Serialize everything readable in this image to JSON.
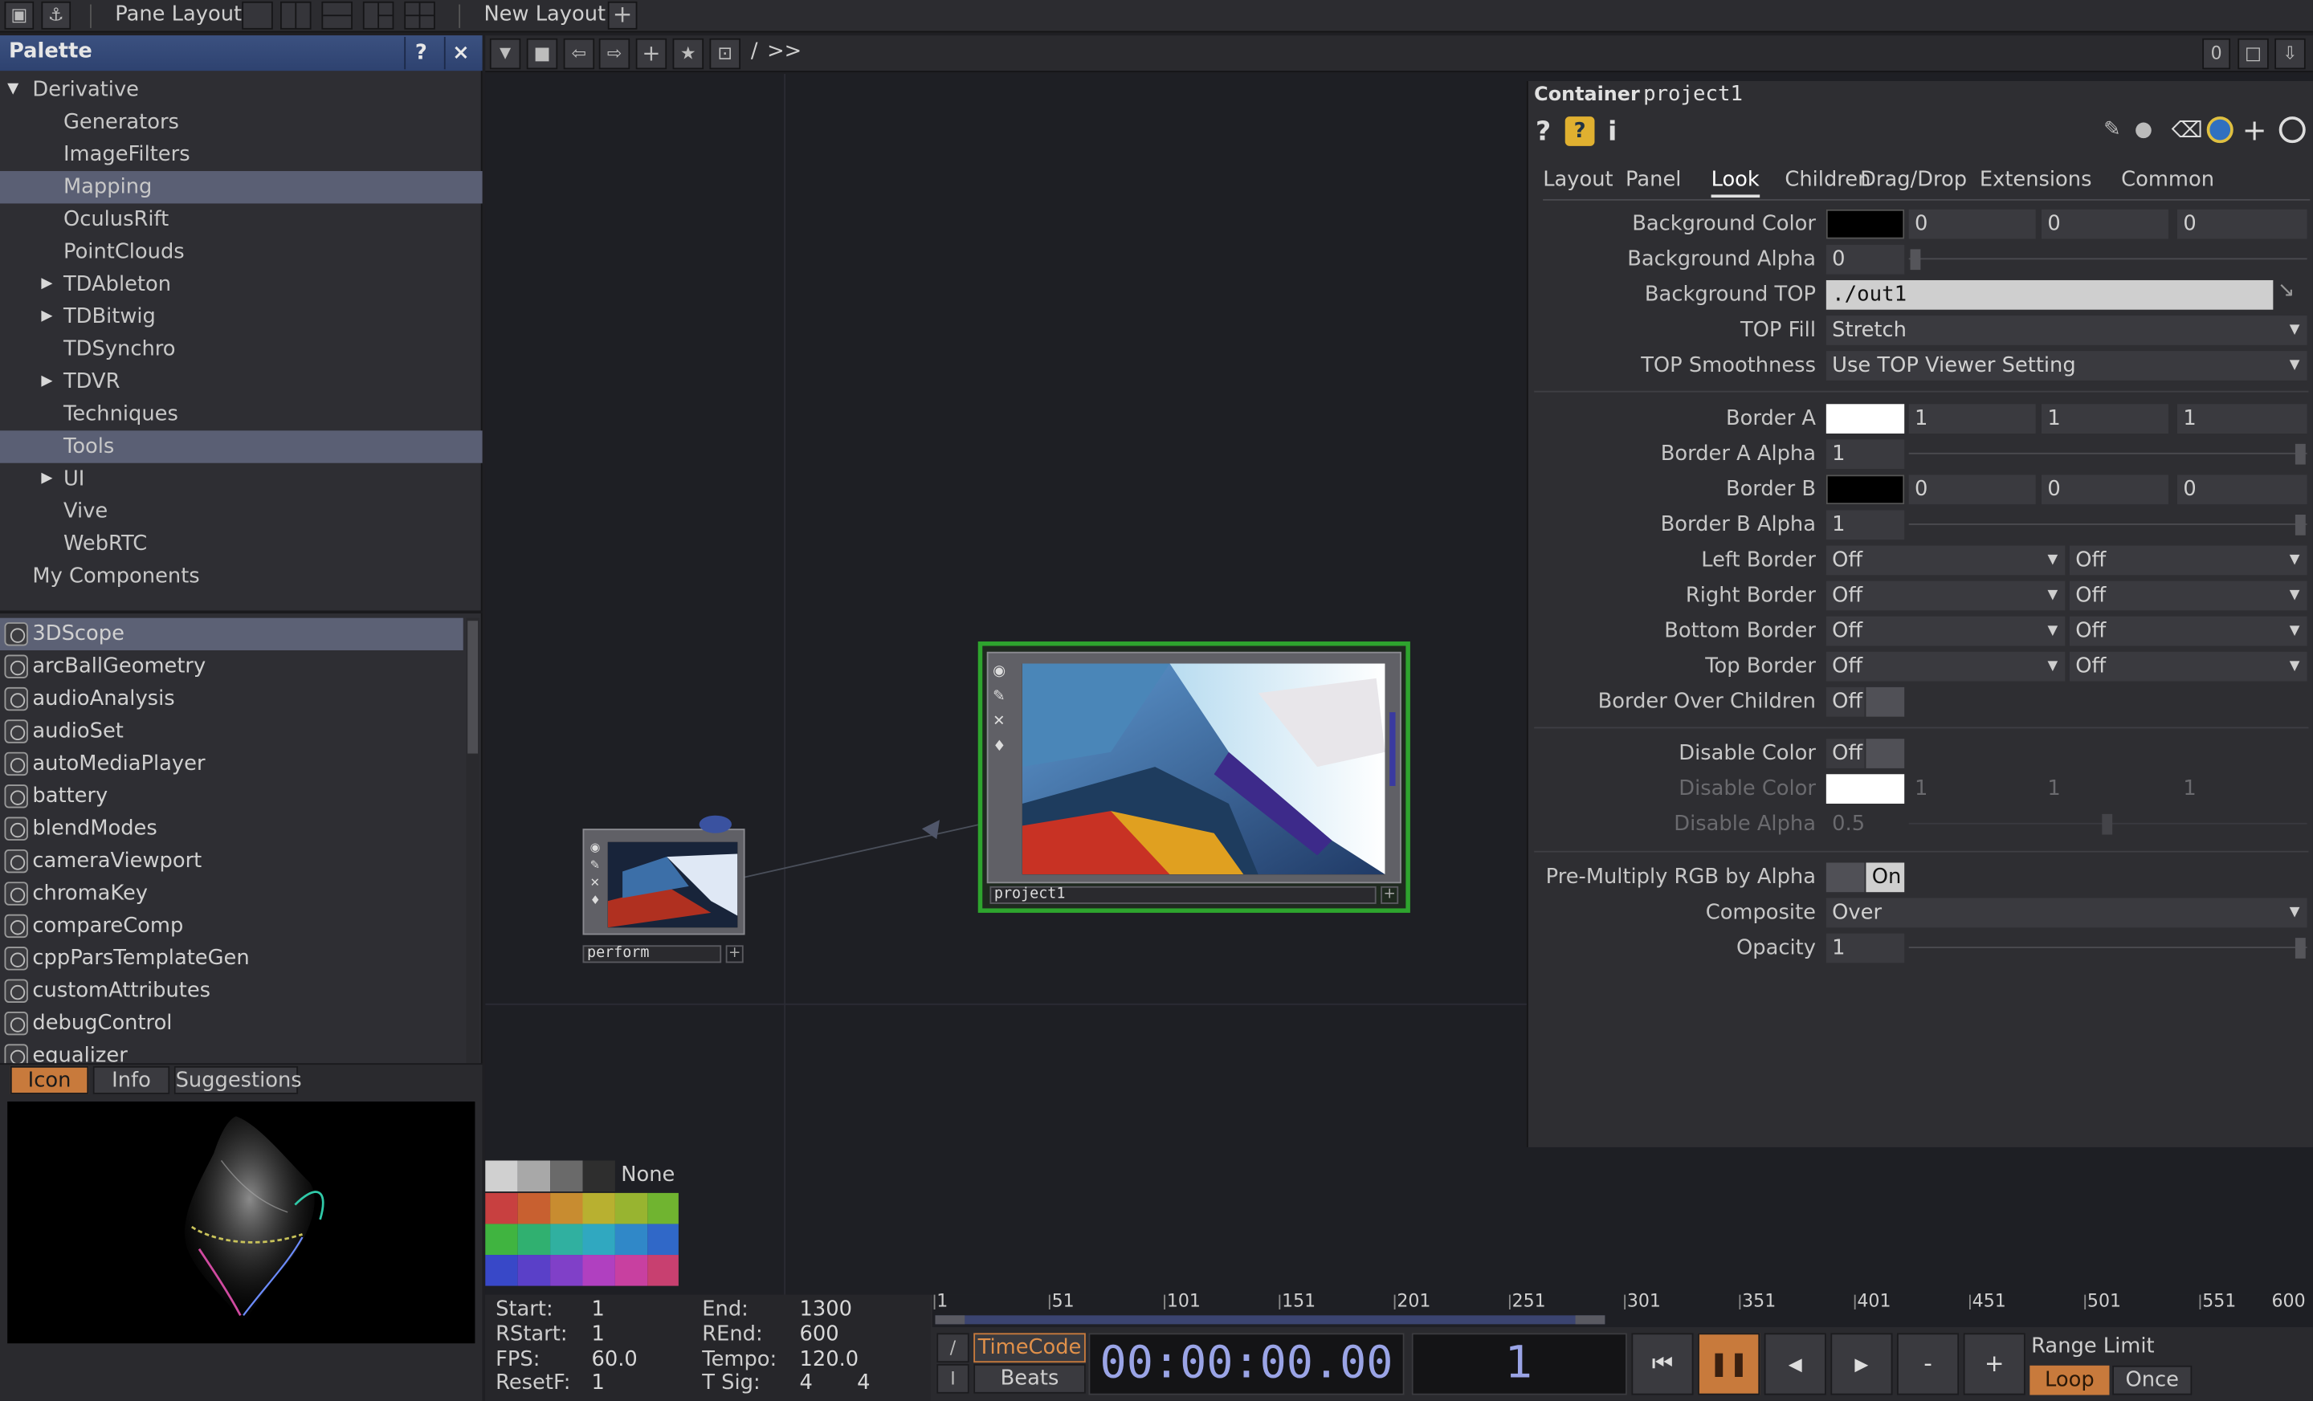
{
  "topbar": {
    "pane_layout_label": "Pane Layout",
    "new_layout_label": "New Layout",
    "add_label": "+"
  },
  "palette": {
    "title": "Palette",
    "help_label": "?",
    "close_label": "×",
    "tree": [
      {
        "label": "Derivative",
        "expanded": true
      },
      {
        "label": "Generators"
      },
      {
        "label": "ImageFilters"
      },
      {
        "label": "Mapping",
        "selected": true
      },
      {
        "label": "OculusRift"
      },
      {
        "label": "PointClouds"
      },
      {
        "label": "TDAbleton",
        "collapsed": true
      },
      {
        "label": "TDBitwig",
        "collapsed": true
      },
      {
        "label": "TDSynchro"
      },
      {
        "label": "TDVR",
        "collapsed": true
      },
      {
        "label": "Techniques"
      },
      {
        "label": "Tools",
        "selected": true
      },
      {
        "label": "UI",
        "collapsed": true
      },
      {
        "label": "Vive"
      },
      {
        "label": "WebRTC"
      },
      {
        "label": "My Components"
      }
    ],
    "components": [
      "3DScope",
      "arcBallGeometry",
      "audioAnalysis",
      "audioSet",
      "autoMediaPlayer",
      "battery",
      "blendModes",
      "cameraViewport",
      "chromaKey",
      "compareComp",
      "cppParsTemplateGen",
      "customAttributes",
      "debugControl",
      "equalizer"
    ],
    "tabs": {
      "icon": "Icon",
      "info": "Info",
      "suggestions": "Suggestions"
    }
  },
  "network": {
    "path": "/",
    "path_more": ">>",
    "counter": "0",
    "nodes": {
      "perform_label": "perform",
      "project_label": "project1"
    },
    "swatch_none_label": "None"
  },
  "params": {
    "op_type": "Container",
    "op_name": "project1",
    "help_label": "?",
    "info_label": "i",
    "tabs": [
      "Layout",
      "Panel",
      "Look",
      "Children",
      "Drag/Drop",
      "Extensions",
      "Common"
    ],
    "active_tab": "Look",
    "background_color": {
      "label": "Background Color",
      "v": [
        "0",
        "0",
        "0"
      ],
      "swatch": "#000000"
    },
    "background_alpha": {
      "label": "Background Alpha",
      "value": "0"
    },
    "background_top": {
      "label": "Background TOP",
      "value": "./out1"
    },
    "top_fill": {
      "label": "TOP Fill",
      "value": "Stretch"
    },
    "top_smoothness": {
      "label": "TOP Smoothness",
      "value": "Use TOP Viewer Setting"
    },
    "border_a": {
      "label": "Border A",
      "v": [
        "1",
        "1",
        "1"
      ],
      "swatch": "#ffffff"
    },
    "border_a_alpha": {
      "label": "Border A Alpha",
      "value": "1"
    },
    "border_b": {
      "label": "Border B",
      "v": [
        "0",
        "0",
        "0"
      ],
      "swatch": "#000000"
    },
    "border_b_alpha": {
      "label": "Border B Alpha",
      "value": "1"
    },
    "left_border": {
      "label": "Left Border",
      "a": "Off",
      "b": "Off"
    },
    "right_border": {
      "label": "Right Border",
      "a": "Off",
      "b": "Off"
    },
    "bottom_border": {
      "label": "Bottom Border",
      "a": "Off",
      "b": "Off"
    },
    "top_border": {
      "label": "Top Border",
      "a": "Off",
      "b": "Off"
    },
    "border_over_children": {
      "label": "Border Over Children",
      "value": "Off"
    },
    "disable_color_toggle": {
      "label": "Disable Color",
      "value": "Off"
    },
    "disable_color": {
      "label": "Disable Color",
      "v": [
        "1",
        "1",
        "1"
      ],
      "swatch": "#ffffff"
    },
    "disable_alpha": {
      "label": "Disable Alpha",
      "value": "0.5"
    },
    "premultiply": {
      "label": "Pre-Multiply RGB by Alpha",
      "value": "On"
    },
    "composite": {
      "label": "Composite",
      "value": "Over"
    },
    "opacity": {
      "label": "Opacity",
      "value": "1"
    }
  },
  "timeline": {
    "start_label": "Start:",
    "start": "1",
    "end_label": "End:",
    "end": "1300",
    "rstart_label": "RStart:",
    "rstart": "1",
    "rend_label": "REnd:",
    "rend": "600",
    "fps_label": "FPS:",
    "fps": "60.0",
    "tempo_label": "Tempo:",
    "tempo": "120.0",
    "resetf_label": "ResetF:",
    "resetf": "1",
    "tsig_label": "T Sig:",
    "tsig_a": "4",
    "tsig_b": "4",
    "ticks": [
      "1",
      "51",
      "101",
      "151",
      "201",
      "251",
      "301",
      "351",
      "401",
      "451",
      "501",
      "551",
      "600"
    ],
    "timecode_label": "TimeCode",
    "beats_label": "Beats",
    "timecode": "00:00:00.00",
    "frame": "1",
    "minus_label": "-",
    "plus_label": "+",
    "range_limit_label": "Range Limit",
    "loop_label": "Loop",
    "once_label": "Once"
  }
}
